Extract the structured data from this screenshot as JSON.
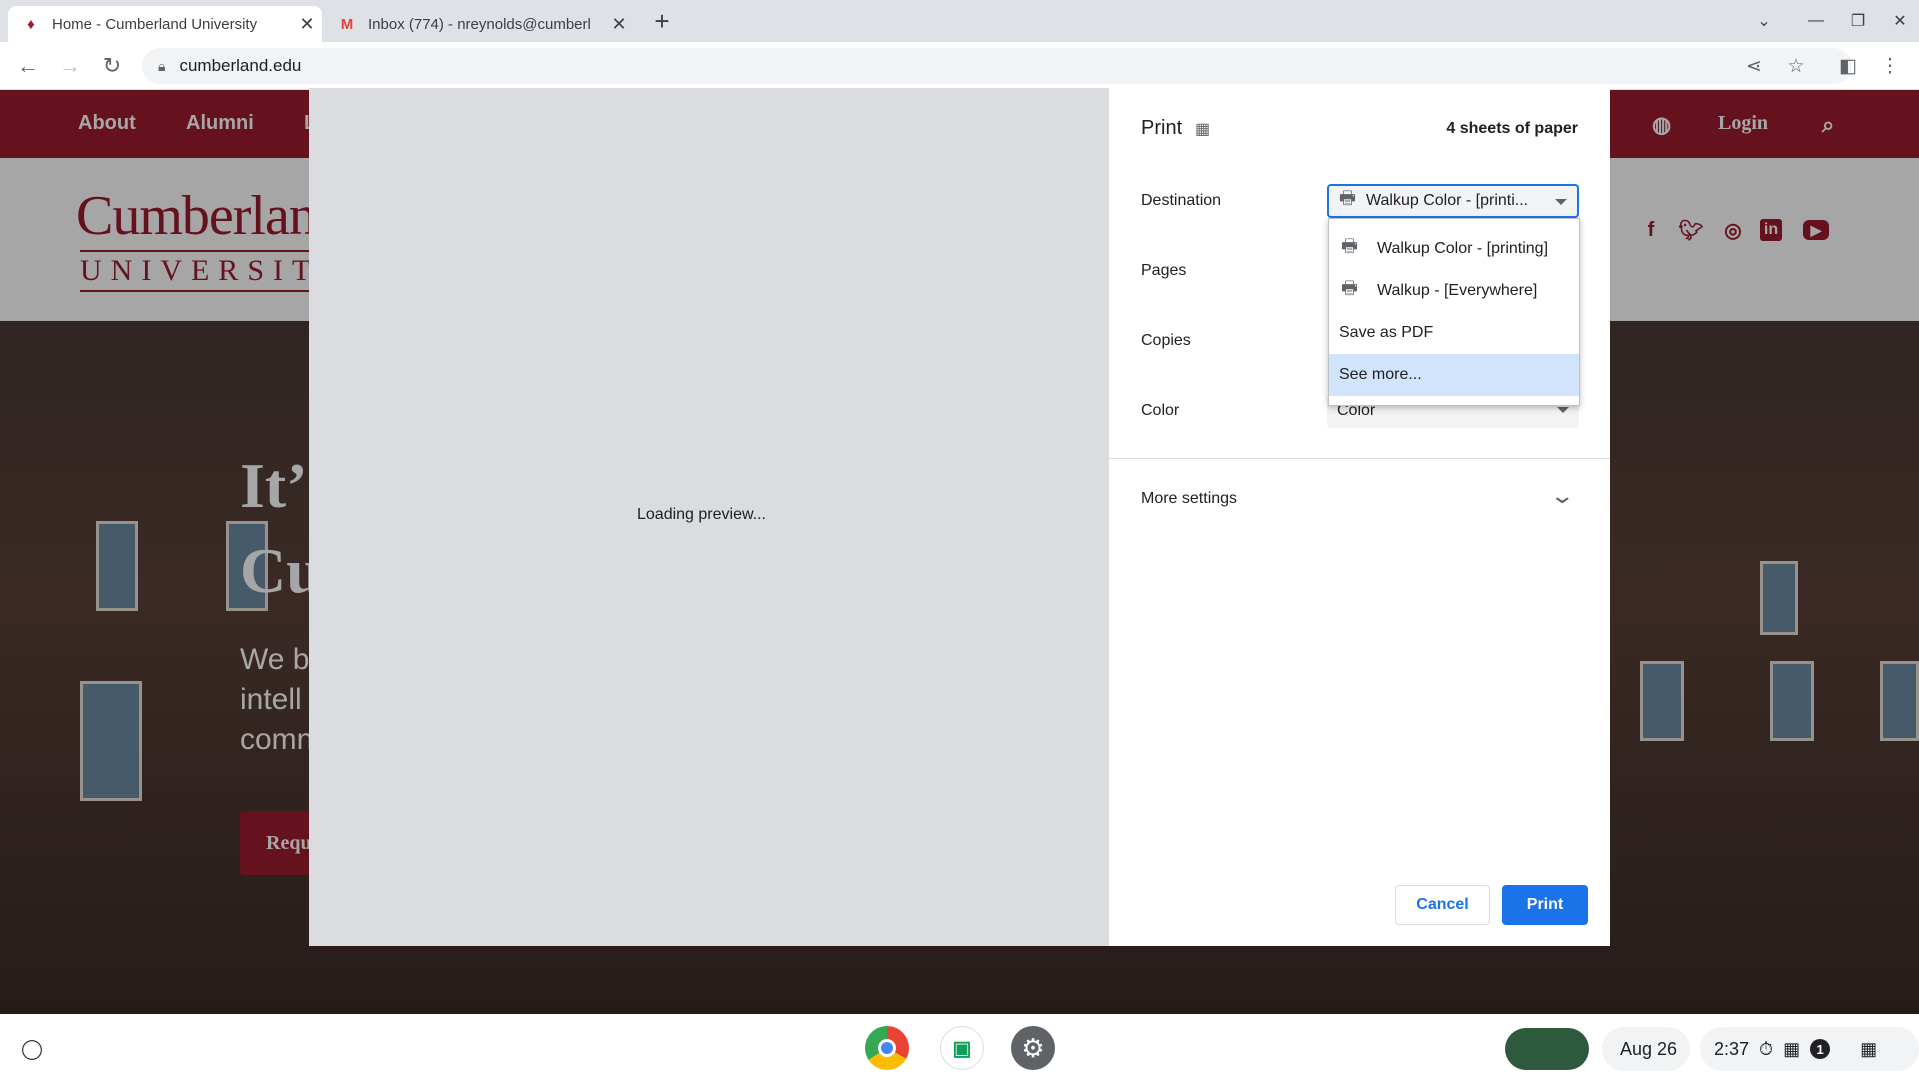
{
  "browser": {
    "tabs": [
      {
        "title": "Home - Cumberland University",
        "active": true
      },
      {
        "title": "Inbox (774) - nreynolds@cumberl",
        "active": false
      }
    ],
    "new_tab": "+",
    "url": "cumberland.edu"
  },
  "site": {
    "nav": [
      "About",
      "Alumni",
      "L"
    ],
    "login": "Login",
    "logo_line1": "Cumberlan",
    "logo_line2": "UNIVERSIT",
    "hero_title_1": "It’",
    "hero_title_2": "Cu",
    "hero_body_1": "We b",
    "hero_body_2": "intell",
    "hero_body_3": "comn",
    "hero_button": "Requ",
    "social_icons": [
      "facebook-icon",
      "twitter-icon",
      "instagram-icon",
      "linkedin-icon",
      "youtube-icon"
    ],
    "brand_color": "#9b1b2f"
  },
  "print": {
    "title": "Print",
    "sheets": "4 sheets of paper",
    "preview_status": "Loading preview...",
    "labels": {
      "destination": "Destination",
      "pages": "Pages",
      "copies": "Copies",
      "color": "Color"
    },
    "destination_value": "Walkup Color - [printi...",
    "color_value": "Color",
    "destination_options": [
      {
        "label": "Walkup Color - [printing]",
        "icon": "printer-icon"
      },
      {
        "label": "Walkup - [Everywhere]",
        "icon": "printer-icon"
      },
      {
        "label": "Save as PDF",
        "icon": ""
      },
      {
        "label": "See more...",
        "icon": "",
        "highlighted": true
      }
    ],
    "more_settings": "More settings",
    "cancel": "Cancel",
    "print_button": "Print",
    "accent": "#1a73e8"
  },
  "shelf": {
    "date": "Aug 26",
    "time": "2:37",
    "notification_count": "1"
  }
}
